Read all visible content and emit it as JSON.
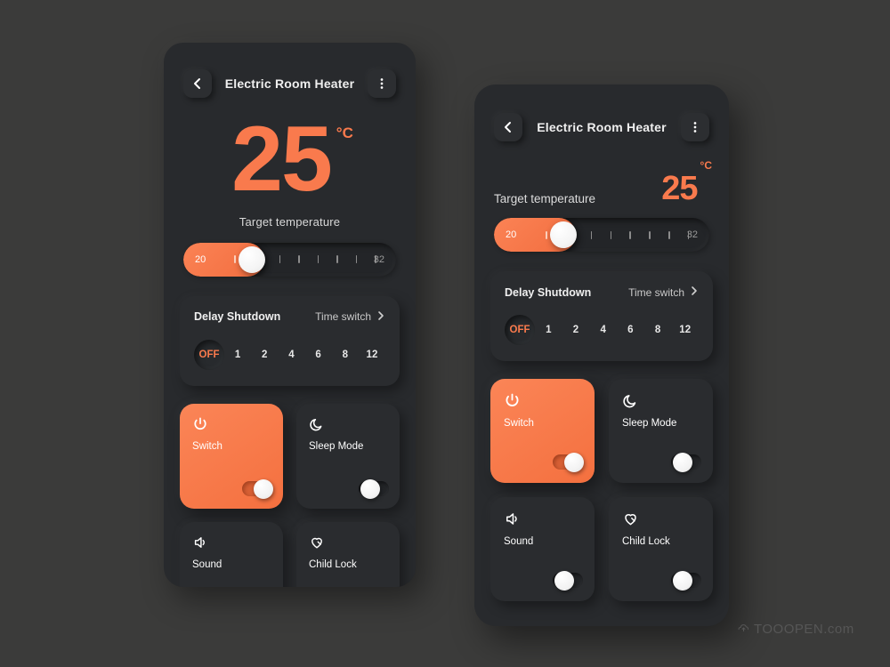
{
  "theme": {
    "accent": "#f97a4d",
    "page_background": "#3b3b3a",
    "phone_background": "#282a2d",
    "card_background": "#2a2c2f",
    "text_primary": "#efefef",
    "text_secondary": "#c9c9c9"
  },
  "app": {
    "title": "Electric Room Heater",
    "back_icon": "chevron-left-icon",
    "menu_icon": "more-vertical-icon"
  },
  "temperature": {
    "value": "25",
    "unit": "°C",
    "caption": "Target temperature",
    "label": "Target temperature"
  },
  "slider": {
    "min_label": "20",
    "max_label": "32",
    "fill_percent": 38,
    "thumb_percent": 34,
    "tick_count": 7
  },
  "delay": {
    "title": "Delay Shutdown",
    "link_label": "Time switch",
    "link_icon": "chevron-right-icon",
    "options": [
      {
        "label": "OFF",
        "selected": true
      },
      {
        "label": "1",
        "selected": false
      },
      {
        "label": "2",
        "selected": false
      },
      {
        "label": "4",
        "selected": false
      },
      {
        "label": "6",
        "selected": false
      },
      {
        "label": "8",
        "selected": false
      },
      {
        "label": "12",
        "selected": false
      }
    ]
  },
  "tiles": [
    {
      "label": "Switch",
      "icon": "power-icon",
      "on": true
    },
    {
      "label": "Sleep Mode",
      "icon": "moon-icon",
      "on": false
    },
    {
      "label": "Sound",
      "icon": "speaker-icon",
      "on": false
    },
    {
      "label": "Child Lock",
      "icon": "child-lock-icon",
      "on": false
    }
  ],
  "watermark": {
    "icon": "cloud-home-icon",
    "text": "TOOOPEN.com"
  }
}
